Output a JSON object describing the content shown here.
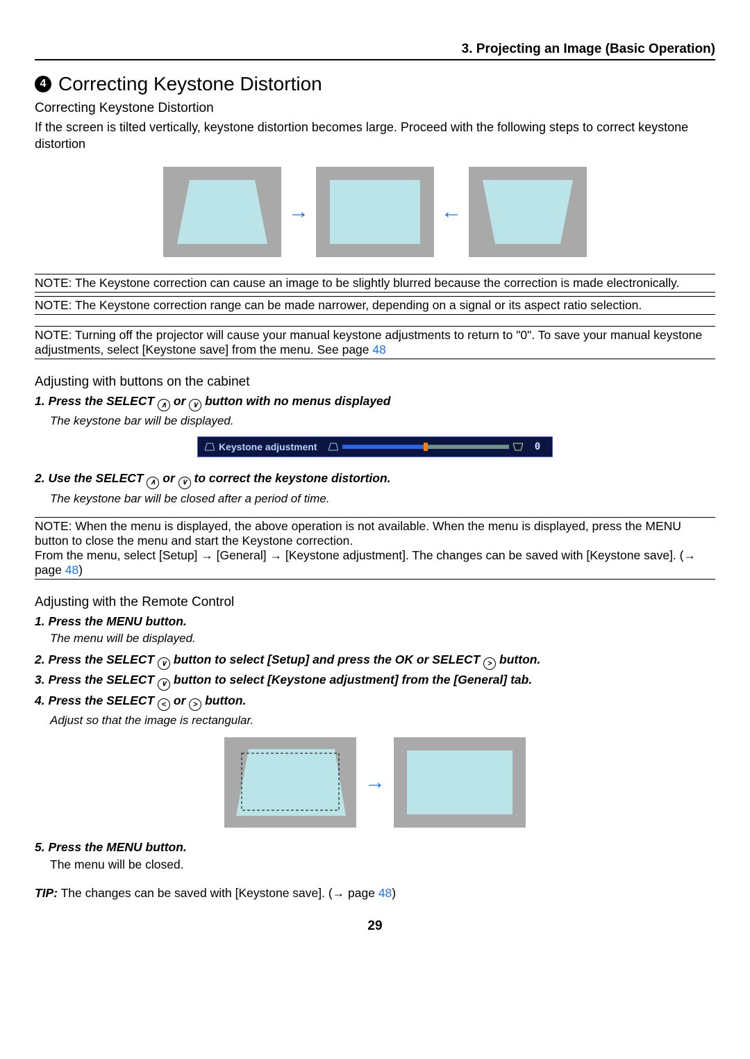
{
  "header": {
    "chapter": "3. Projecting an Image (Basic Operation)"
  },
  "title": {
    "bullet": "4",
    "text": "Correcting Keystone Distortion"
  },
  "subtitle": "Correcting Keystone Distortion",
  "intro": "If the screen is tilted vertically, keystone distortion becomes large. Proceed with the following steps to correct keystone distortion",
  "notes": {
    "n1": "NOTE: The Keystone correction can cause an image to be slightly blurred because the correction is made electronically.",
    "n2": "NOTE: The Keystone correction range can be made narrower, depending on a signal or its aspect ratio selection.",
    "n3_a": "NOTE: Turning off the projector will cause your manual keystone adjustments to return to \"0\". To save your manual keystone adjustments, select [Keystone save] from the menu. See page ",
    "n3_link": "48",
    "n4_a": "NOTE: When the menu is displayed, the above operation is not available. When the menu is displayed, press the MENU button to close the menu and start the Keystone correction.",
    "n4_b": "From the menu, select [Setup] → [General] → [Keystone adjustment]. The changes can be saved with [Keystone save]. (→ page ",
    "n4_link": "48",
    "n4_c": ")"
  },
  "cabinet": {
    "heading": "Adjusting with buttons on the cabinet",
    "s1_a": "1.  Press the SELECT ",
    "s1_b": " or ",
    "s1_c": " button with no menus displayed",
    "s1_it": "The keystone bar will be displayed.",
    "bar": {
      "label": "Keystone adjustment",
      "value": "0"
    },
    "s2_a": "2.  Use the SELECT ",
    "s2_b": " or ",
    "s2_c": " to correct the keystone distortion.",
    "s2_it": "The keystone bar will be closed after a period of time."
  },
  "remote": {
    "heading": "Adjusting with the Remote Control",
    "s1": "1.  Press the MENU button.",
    "s1_it": "The menu will be displayed.",
    "s2_a": "2.  Press the SELECT ",
    "s2_b": " button to select [Setup] and press the OK or SELECT ",
    "s2_c": " button.",
    "s3_a": "3.  Press the SELECT ",
    "s3_b": " button to select [Keystone adjustment] from the [General] tab.",
    "s4_a": "4.  Press the SELECT ",
    "s4_b": " or ",
    "s4_c": " button.",
    "s4_it": "Adjust so that the image is rectangular.",
    "s5": "5.  Press the MENU button.",
    "s5_p": "The menu will be closed."
  },
  "tip": {
    "label": "TIP:",
    "text_a": " The changes can be saved with [Keystone save]. (→ page ",
    "link": "48",
    "text_b": ")"
  },
  "pagenum": "29",
  "icons": {
    "up": "∧",
    "down": "∨",
    "left": "<",
    "right": ">"
  }
}
